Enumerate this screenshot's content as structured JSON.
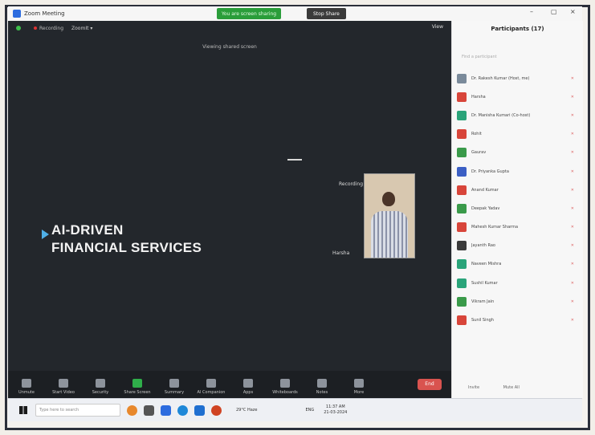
{
  "window": {
    "title": "Zoom Meeting",
    "share_banner": "You are screen sharing",
    "stop_share_label": "Stop Share",
    "minimize": "–",
    "maximize": "▢",
    "close": "×"
  },
  "meeting": {
    "recording_label": "Recording",
    "top_indicator": "ZoomIt ▾",
    "view_label": "View",
    "viewing_label": "Viewing shared screen",
    "slide_line1": "AI-DRIVEN",
    "slide_line2": "FINANCIAL SERVICES",
    "tile_label_recording": "Recording",
    "tile_label_name": "Harsha",
    "toolbar": [
      {
        "label": "Unmute",
        "icon": "microphone-icon"
      },
      {
        "label": "Start Video",
        "icon": "video-camera-icon"
      },
      {
        "label": "Security",
        "icon": "shield-icon"
      },
      {
        "label": "Share Screen",
        "icon": "share-screen-icon"
      },
      {
        "label": "Summary",
        "icon": "summary-icon"
      },
      {
        "label": "AI Companion",
        "icon": "sparkle-icon"
      },
      {
        "label": "Apps",
        "icon": "apps-icon"
      },
      {
        "label": "Whiteboards",
        "icon": "whiteboard-icon"
      },
      {
        "label": "Notes",
        "icon": "notes-icon"
      },
      {
        "label": "More",
        "icon": "more-icon"
      }
    ],
    "end_label": "End"
  },
  "panel": {
    "title": "Participants (17)",
    "search_placeholder": "Find a participant",
    "participants": [
      {
        "name": "Dr. Rakesh Kumar (Host, me)",
        "color": "#7a8a9a"
      },
      {
        "name": "Harsha",
        "color": "#d8453a"
      },
      {
        "name": "Dr. Manisha Kumari (Co-host)",
        "color": "#2aa47a"
      },
      {
        "name": "Rohit",
        "color": "#d8453a"
      },
      {
        "name": "Gaurav",
        "color": "#3a9a4a"
      },
      {
        "name": "Dr. Priyanka Gupta",
        "color": "#3b5fc4"
      },
      {
        "name": "Anand Kumar",
        "color": "#d8453a"
      },
      {
        "name": "Deepak Yadav",
        "color": "#3a9a4a"
      },
      {
        "name": "Mahesh Kumar Sharma",
        "color": "#d8453a"
      },
      {
        "name": "Jayanth Rao",
        "color": "#3a3a3a"
      },
      {
        "name": "Naveen Mishra",
        "color": "#2aa47a"
      },
      {
        "name": "Sushil Kumar",
        "color": "#2aa47a"
      },
      {
        "name": "Vikram Jain",
        "color": "#3a9a4a"
      },
      {
        "name": "Sunil Singh",
        "color": "#d8453a"
      }
    ],
    "footer_invite": "Invite",
    "footer_mute_all": "Mute All"
  },
  "taskbar": {
    "search_placeholder": "Type here to search",
    "weather": "29°C Haze",
    "system_tray": "ENG",
    "time": "11:37 AM",
    "date": "21-03-2024"
  }
}
